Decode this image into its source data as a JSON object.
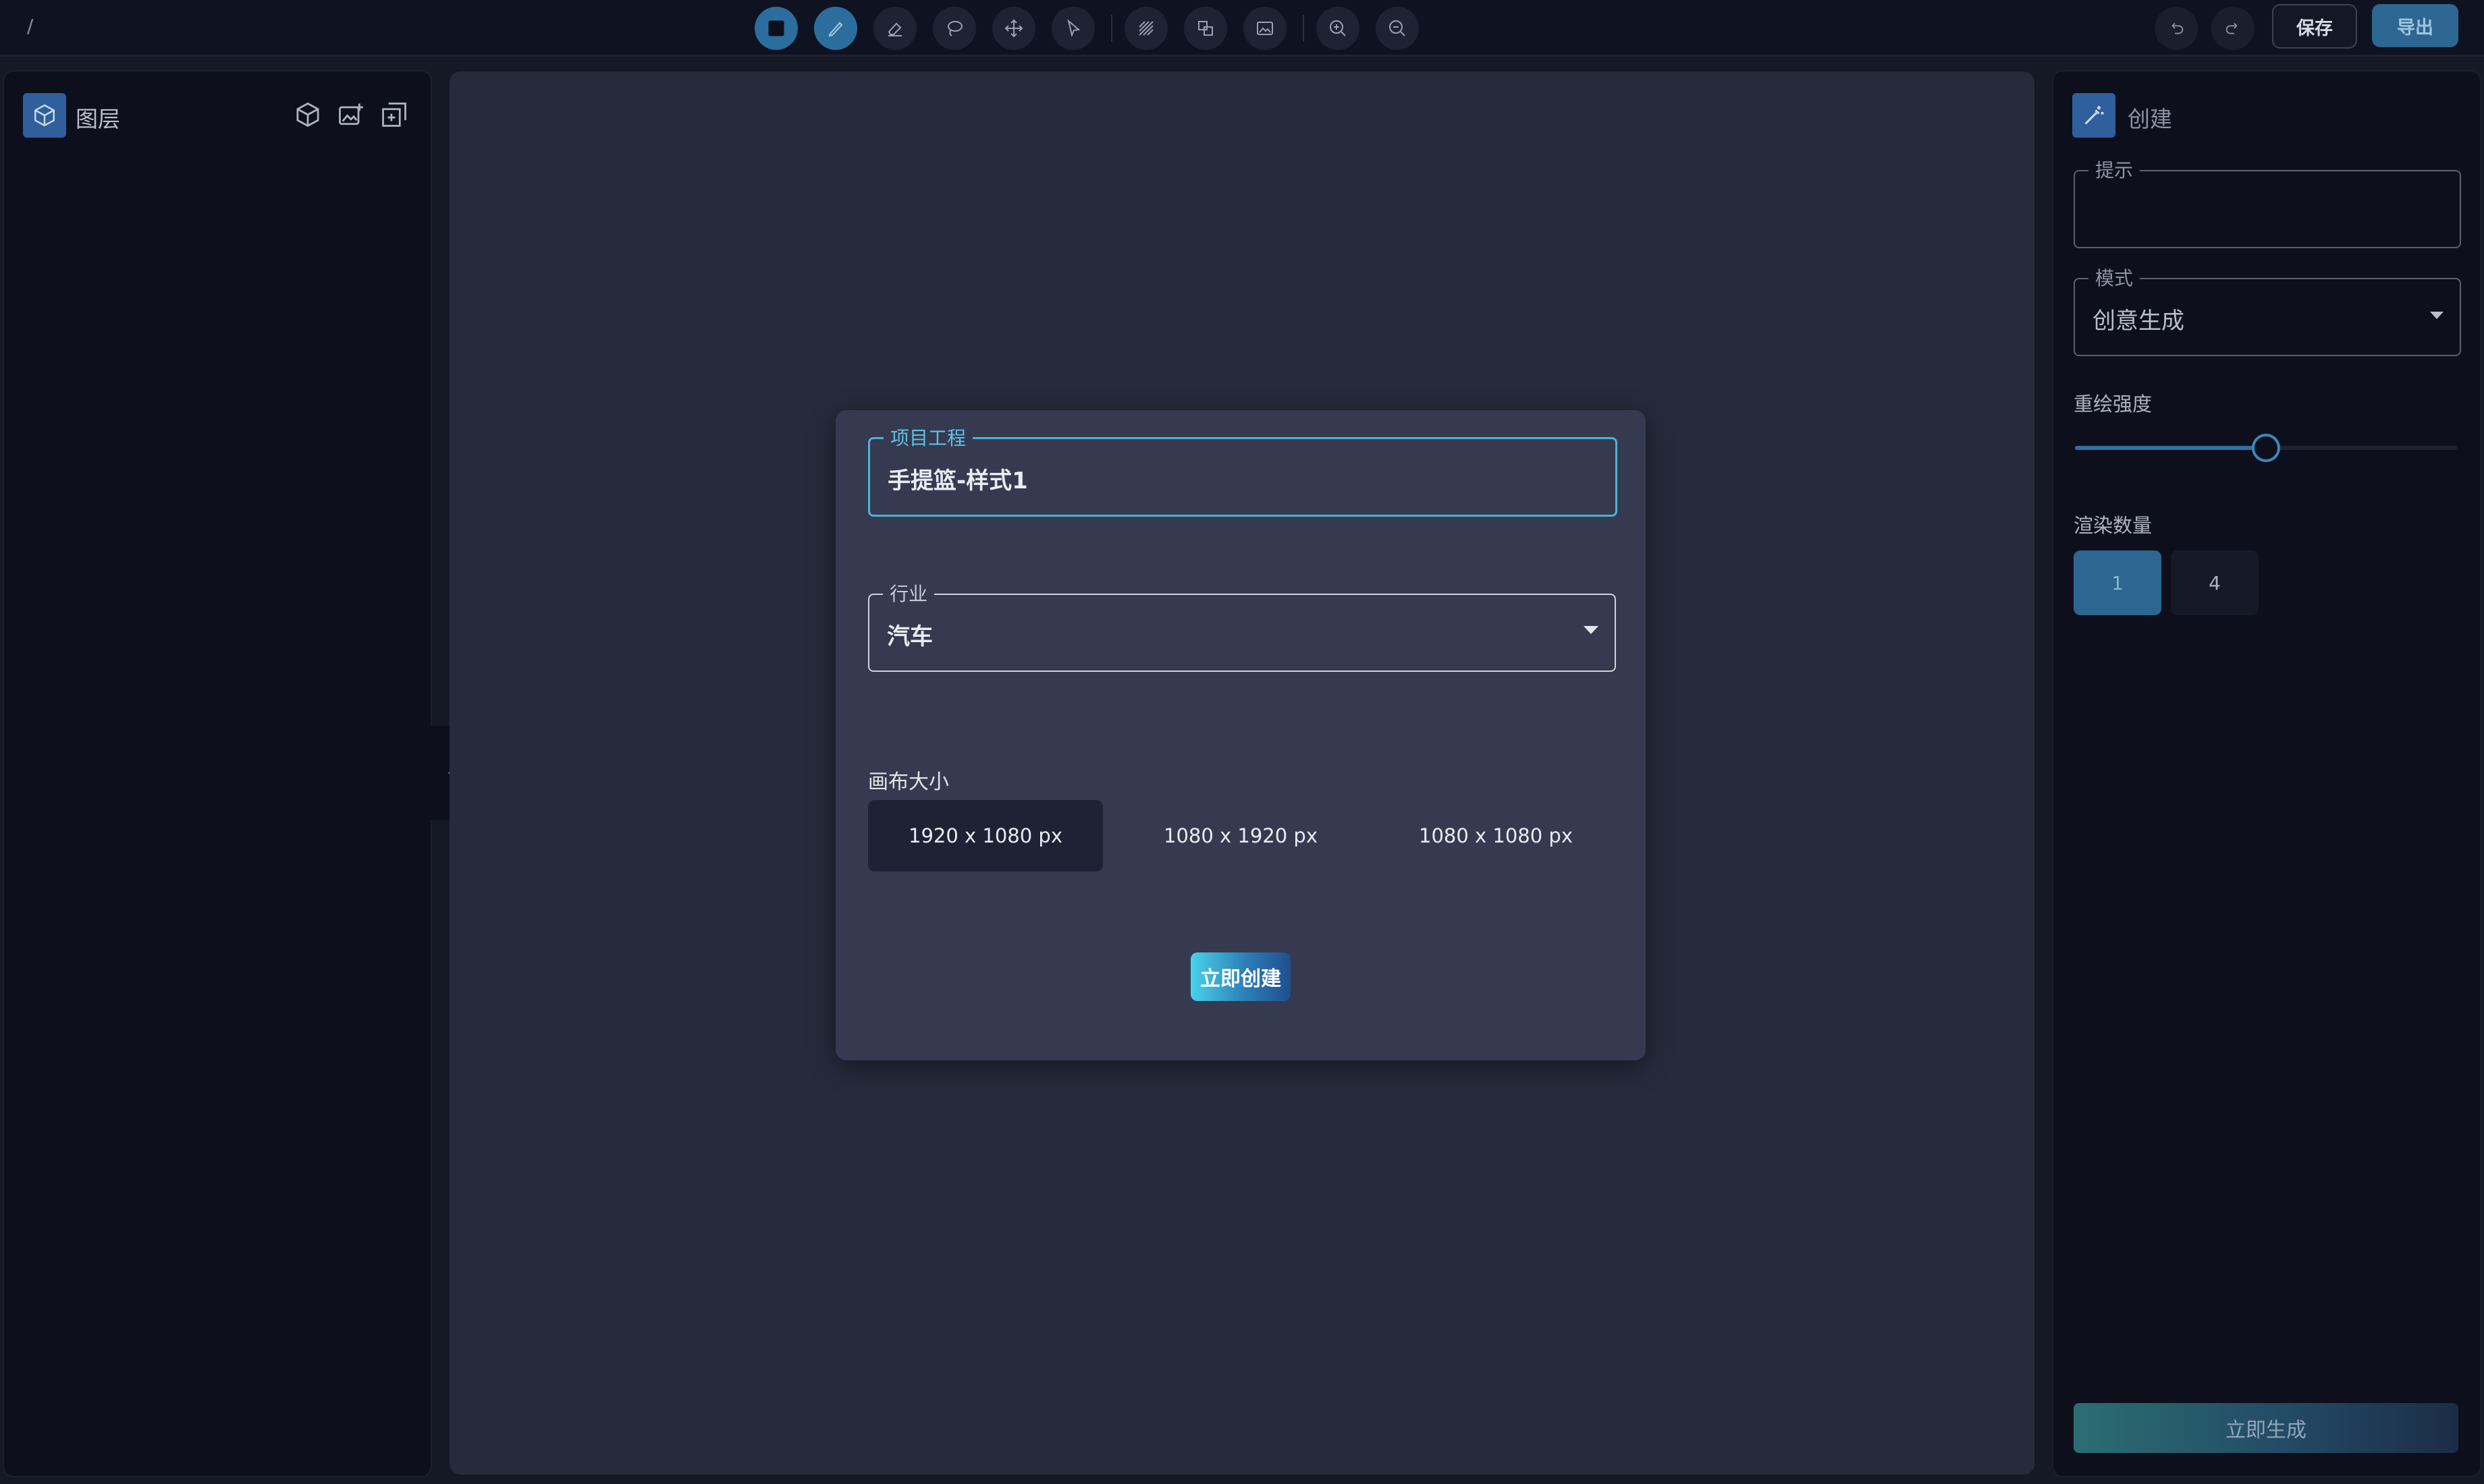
{
  "breadcrumb": "/",
  "toolbar": {
    "tools": [
      {
        "icon": "rectangle-icon",
        "active": true
      },
      {
        "icon": "brush-icon",
        "active": true
      },
      {
        "icon": "eraser-icon",
        "active": false
      },
      {
        "icon": "lasso-icon",
        "active": false
      },
      {
        "icon": "move-icon",
        "active": false
      },
      {
        "icon": "pointer-icon",
        "active": false
      },
      {
        "icon": "hatch-icon",
        "active": false
      },
      {
        "icon": "layers-swap-icon",
        "active": false
      },
      {
        "icon": "image-frame-icon",
        "active": false
      },
      {
        "icon": "zoom-in-icon",
        "active": false
      },
      {
        "icon": "zoom-out-icon",
        "active": false
      }
    ],
    "undo_icon": "undo-icon",
    "redo_icon": "redo-icon",
    "save_label": "保存",
    "export_label": "导出"
  },
  "left_panel": {
    "title": "图层",
    "actions": [
      "cube-icon",
      "add-image-icon",
      "add-layer-icon"
    ]
  },
  "modal": {
    "project": {
      "legend": "项目工程",
      "value": "手提篮-样式1"
    },
    "industry": {
      "legend": "行业",
      "value": "汽车"
    },
    "canvas_size": {
      "label": "画布大小",
      "options": [
        "1920 x 1080 px",
        "1080 x 1920 px",
        "1080 x 1080 px"
      ],
      "selected": "1920 x 1080 px"
    },
    "create_label": "立即创建"
  },
  "right_panel": {
    "title": "创建",
    "prompt": {
      "legend": "提示",
      "value": ""
    },
    "mode": {
      "legend": "模式",
      "value": "创意生成"
    },
    "strength": {
      "label": "重绘强度",
      "value": 0.5
    },
    "render_count": {
      "label": "渲染数量",
      "options": [
        "1",
        "4"
      ],
      "selected": "1"
    },
    "generate_label": "立即生成"
  },
  "colors": {
    "accent": "#2d6690",
    "focus": "#4bb3d9",
    "background": "#151825",
    "modal": "#353a50"
  }
}
